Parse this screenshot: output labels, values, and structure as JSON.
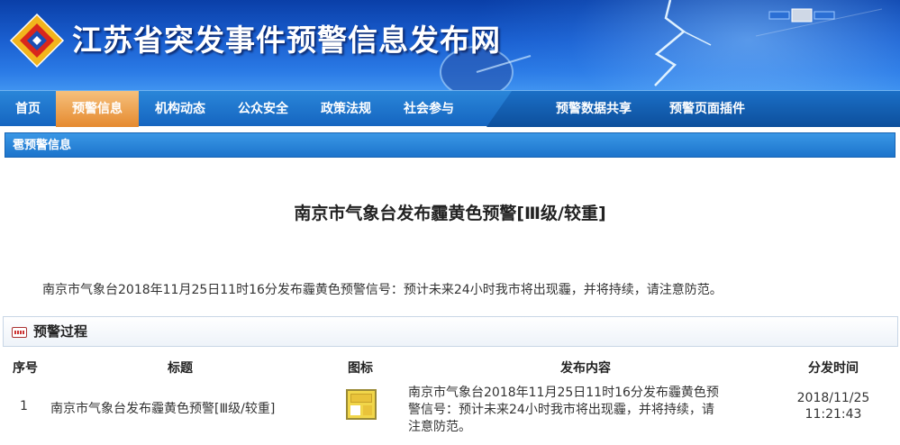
{
  "site": {
    "title": "江苏省突发事件预警信息发布网"
  },
  "nav": {
    "items": [
      "首页",
      "预警信息",
      "机构动态",
      "公众安全",
      "政策法规",
      "社会参与"
    ],
    "right_items": [
      "预警数据共享",
      "预警页面插件"
    ],
    "active_index": 1
  },
  "section": {
    "label": "雹预警信息"
  },
  "article": {
    "title": "南京市气象台发布霾黄色预警[Ⅲ级/较重]",
    "body": "南京市气象台2018年11月25日11时16分发布霾黄色预警信号：预计未来24小时我市将出现霾，并将持续，请注意防范。"
  },
  "process": {
    "header": "预警过程",
    "columns": [
      "序号",
      "标题",
      "图标",
      "发布内容",
      "分发时间"
    ],
    "rows": [
      {
        "index": "1",
        "title": "南京市气象台发布霾黄色预警[Ⅲ级/较重]",
        "content_line1": "南京市气象台2018年11月25日11时16分发布霾黄色预",
        "content_line2": "警信号：预计未来24小时我市将出现霾，并将持续，请",
        "content_line3": "注意防范。",
        "date": "2018/11/25",
        "time": "11:21:43"
      }
    ]
  },
  "colors": {
    "banner": "#1a5fd0",
    "nav": "#1565c0",
    "nav_active": "#e58a2f",
    "warning_yellow": "#f1d64a"
  }
}
